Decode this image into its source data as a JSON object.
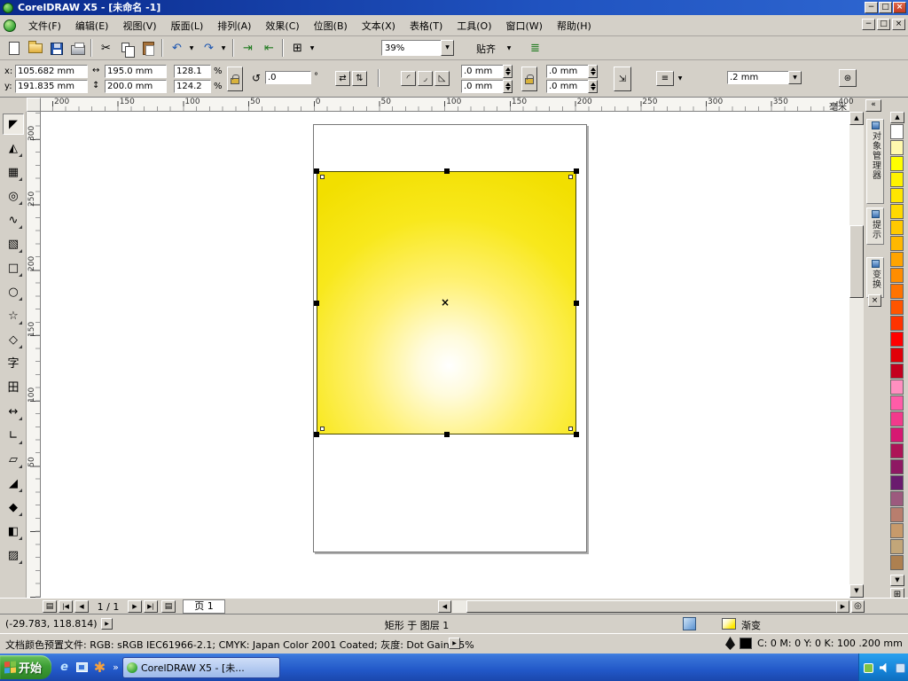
{
  "titlebar": {
    "title": "CorelDRAW X5 - [未命名 -1]"
  },
  "menubar": {
    "items": [
      "文件(F)",
      "编辑(E)",
      "视图(V)",
      "版面(L)",
      "排列(A)",
      "效果(C)",
      "位图(B)",
      "文本(X)",
      "表格(T)",
      "工具(O)",
      "窗口(W)",
      "帮助(H)"
    ]
  },
  "std_toolbar": {
    "zoom_value": "39%",
    "snap_label": "贴齐"
  },
  "icons": {
    "minimize": "−",
    "restore": "□",
    "close": "×",
    "cut": "✂",
    "undo": "↶",
    "redo": "↷",
    "import": "⇥",
    "export": "⇤",
    "launcher": "⊞",
    "options": "≣",
    "dropdown": "▼",
    "up": "▲",
    "down": "▼",
    "left": "◀",
    "right": "▶",
    "width": "↔",
    "height": "↕",
    "rotate": "↺",
    "mirror_h": "⇄",
    "mirror_v": "⇅",
    "corner_round": "◜",
    "corner_scallop": "◞",
    "corner_chamfer": "◺",
    "scale_stroke": "⇲",
    "wrap": "≡",
    "sym": "⊛",
    "collapse": "«",
    "expand": "⊞",
    "zoom_fit": "◎",
    "pan_first": "|◀",
    "pan_prev": "◀",
    "pan_next": "▶",
    "pan_last": "▶|",
    "page_flip": "▤",
    "add_page": "▤",
    "arrow_small": "▶",
    "chevron": "»",
    "ie": "e"
  },
  "property_bar": {
    "x_label": "x:",
    "y_label": "y:",
    "x_value": "105.682 mm",
    "y_value": "191.835 mm",
    "width_value": "195.0 mm",
    "height_value": "200.0 mm",
    "scale_h_value": "128.1",
    "scale_v_value": "124.2",
    "percent": "%",
    "degree": "°",
    "rotation_value": ".0",
    "corner_values": [
      ".0 mm",
      ".0 mm",
      ".0 mm",
      ".0 mm"
    ],
    "outline_width_value": ".2 mm"
  },
  "rulers": {
    "h_labels": [
      "200",
      "150",
      "100",
      "50",
      "0",
      "50",
      "100",
      "150",
      "200",
      "250",
      "300",
      "350",
      "400"
    ],
    "v_labels": [
      "300",
      "250",
      "200",
      "150",
      "100",
      "50"
    ],
    "unit": "毫米"
  },
  "toolbox": {
    "tools": [
      {
        "name": "pick-tool",
        "glyph": "◤",
        "flyout": false
      },
      {
        "name": "shape-tool",
        "glyph": "◭",
        "flyout": true
      },
      {
        "name": "crop-tool",
        "glyph": "▦",
        "flyout": true
      },
      {
        "name": "zoom-tool",
        "glyph": "◎",
        "flyout": true
      },
      {
        "name": "freehand-tool",
        "glyph": "∿",
        "flyout": true
      },
      {
        "name": "smart-fill-tool",
        "glyph": "▧",
        "flyout": true
      },
      {
        "name": "rectangle-tool",
        "glyph": "□",
        "flyout": true
      },
      {
        "name": "ellipse-tool",
        "glyph": "○",
        "flyout": true
      },
      {
        "name": "polygon-tool",
        "glyph": "☆",
        "flyout": true
      },
      {
        "name": "basic-shapes-tool",
        "glyph": "◇",
        "flyout": true
      },
      {
        "name": "text-tool",
        "glyph": "字",
        "flyout": false
      },
      {
        "name": "table-tool",
        "glyph": "田",
        "flyout": false
      },
      {
        "name": "dimension-tool",
        "glyph": "↔",
        "flyout": true
      },
      {
        "name": "connector-tool",
        "glyph": "∟",
        "flyout": true
      },
      {
        "name": "blend-tool",
        "glyph": "▱",
        "flyout": true
      },
      {
        "name": "eyedropper-tool",
        "glyph": "◢",
        "flyout": true
      },
      {
        "name": "outline-pen-tool",
        "glyph": "◆",
        "flyout": true
      },
      {
        "name": "fill-tool",
        "glyph": "◧",
        "flyout": true
      },
      {
        "name": "interactive-fill-tool",
        "glyph": "▨",
        "flyout": true
      }
    ]
  },
  "canvas": {
    "fill_center": "#FFFFFF",
    "fill_edge": "#F2DF00"
  },
  "dockers": {
    "tabs": [
      "对象管理器",
      "提示",
      "变换"
    ]
  },
  "palette": {
    "colors": [
      "#FFFFFF",
      "#FFF9AE",
      "#FFFF00",
      "#FFF200",
      "#FFE600",
      "#FFD900",
      "#FFC900",
      "#FFB800",
      "#FFA400",
      "#FF8D00",
      "#FF7300",
      "#FF5500",
      "#FF3300",
      "#FF0000",
      "#E00008",
      "#C4001E",
      "#FF8FC0",
      "#FF5CA8",
      "#F23A8C",
      "#D61872",
      "#AD1457",
      "#8E1963",
      "#6A1B6E",
      "#9C5A7E",
      "#B87E6E",
      "#C79A6B",
      "#C2A679",
      "#AD8050"
    ]
  },
  "page_nav": {
    "counter": "1 / 1",
    "page_tab": "页 1"
  },
  "statusbar": {
    "coords": "(-29.783, 118.814)",
    "object_info": "矩形 于 图层 1",
    "fill_label": "渐变",
    "outline_info": "C: 0 M: 0 Y: 0 K: 100   .200 mm",
    "doc_profile": "文档颜色预置文件: RGB: sRGB IEC61966-2.1; CMYK: Japan Color 2001 Coated; 灰度: Dot Gain 15%"
  },
  "taskbar": {
    "start_label": "开始",
    "task_label": "CorelDRAW X5 - [未..."
  }
}
